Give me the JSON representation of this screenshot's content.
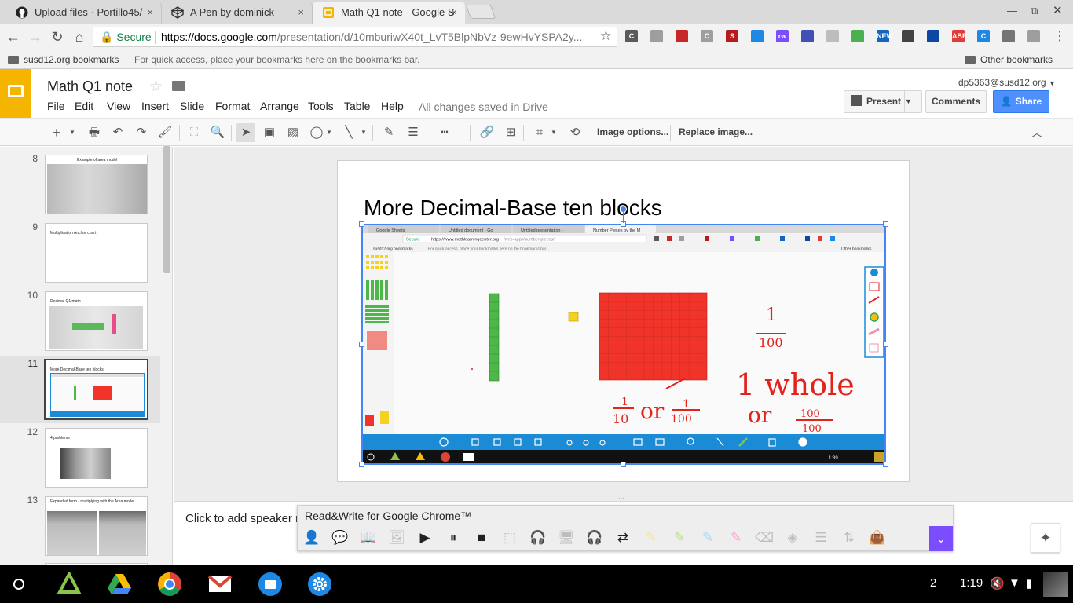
{
  "browser": {
    "tabs": [
      {
        "title": "Upload files · Portillo45/",
        "favicon": "github-icon",
        "active": false
      },
      {
        "title": "A Pen by dominick",
        "favicon": "codepen-icon",
        "active": false
      },
      {
        "title": "Math Q1 note - Google S",
        "favicon": "google-slides-icon",
        "active": true
      }
    ],
    "close_glyph": "×",
    "secure_label": "Secure",
    "url_host": "https://docs.google.com",
    "url_path": "/presentation/d/10mburiwX40t_LvT5BlpNbVz-9ewHvYSPA2y...",
    "extensions": [
      {
        "label": "C",
        "color": "#5a5a5a"
      },
      {
        "label": "",
        "color": "#9e9e9e"
      },
      {
        "label": "",
        "color": "#c62828"
      },
      {
        "label": "C",
        "color": "#9e9e9e"
      },
      {
        "label": "S",
        "color": "#b71c1c"
      },
      {
        "label": "",
        "color": "#1e88e5"
      },
      {
        "label": "rw",
        "color": "#7c4dff"
      },
      {
        "label": "",
        "color": "#3f51b5"
      },
      {
        "label": "",
        "color": "#bdbdbd"
      },
      {
        "label": "",
        "color": "#4caf50"
      },
      {
        "label": "NEW",
        "color": "#1565c0"
      },
      {
        "label": "",
        "color": "#424242"
      },
      {
        "label": "",
        "color": "#0d47a1"
      },
      {
        "label": "ABP",
        "color": "#e53935"
      },
      {
        "label": "C",
        "color": "#1e88e5"
      },
      {
        "label": "",
        "color": "#757575"
      },
      {
        "label": "",
        "color": "#9e9e9e"
      }
    ],
    "bookmarks": {
      "folder": "susd12.org bookmarks",
      "hint": "For quick access, place your bookmarks here on the bookmarks bar.",
      "other": "Other bookmarks"
    }
  },
  "docs": {
    "title": "Math Q1 note",
    "account": "dp5363@susd12.org",
    "menus": [
      "File",
      "Edit",
      "View",
      "Insert",
      "Slide",
      "Format",
      "Arrange",
      "Tools",
      "Table",
      "Help"
    ],
    "saved_status": "All changes saved in Drive",
    "present_label": "Present",
    "comments_label": "Comments",
    "share_label": "Share",
    "image_options_label": "Image options...",
    "replace_image_label": "Replace image..."
  },
  "filmstrip": [
    {
      "num": "8",
      "title": "Example of area model"
    },
    {
      "num": "9",
      "title": "Multiplication Anchor chart"
    },
    {
      "num": "10",
      "title": "Decimal Q1 math"
    },
    {
      "num": "11",
      "title": "More Decimal-Base ten blocks",
      "selected": true
    },
    {
      "num": "12",
      "title": "4 problems"
    },
    {
      "num": "13",
      "title": "Expanded form - multiplying with the Area model"
    }
  ],
  "slide": {
    "title": "More Decimal-Base ten blocks",
    "screenshot": {
      "tabs": [
        "Google Sheets",
        "Untitled document - Go",
        "Untitled presentation -",
        "Number Pieces by the M"
      ],
      "secure_label": "Secure",
      "url_host": "https://www.mathlearningcenter.org",
      "url_path": "/web-apps/number-pieces/",
      "bookmarks_folder": "susd12.org bookmarks",
      "bookmarks_hint": "For quick access, place your bookmarks here on the bookmarks bar.",
      "bookmarks_other": "Other bookmarks",
      "handwriting": {
        "frac1_num": "1",
        "frac1_den": "100",
        "whole": "1 whole",
        "or1": "or",
        "frac2_num": "1",
        "frac2_den": "10",
        "frac3_num": "1",
        "frac3_den": "100",
        "or2": "or",
        "frac4_num": "100",
        "frac4_den": "100"
      },
      "time": "1:39"
    }
  },
  "notes_placeholder": "Click to add speaker n",
  "readwrite": {
    "title": "Read&Write for Google Chrome™"
  },
  "shelf": {
    "notif_count": "2",
    "time": "1:19"
  },
  "colors": {
    "slides_yellow": "#f4b400",
    "share_blue": "#4d90fe",
    "selection_blue": "#4285f4",
    "mlc_blue": "#1b8bd6",
    "block_red": "#f0342a",
    "rod_green": "#4db848",
    "unit_yellow": "#f5d21f",
    "ink_red": "#e3221c"
  }
}
